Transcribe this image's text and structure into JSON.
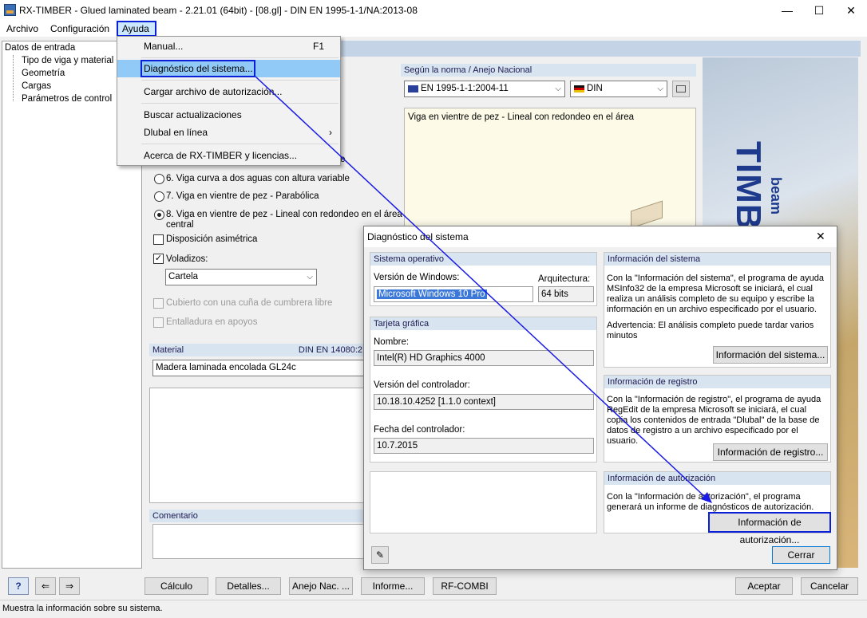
{
  "window": {
    "title": "RX-TIMBER - Glued laminated beam - 2.21.01 (64bit) - [08.gl] - DIN EN 1995-1-1/NA:2013-08",
    "minimize": "—",
    "maximize": "☐",
    "close": "✕"
  },
  "menubar": {
    "items": [
      "Archivo",
      "Configuración",
      "Ayuda"
    ]
  },
  "tree": {
    "root": "Datos de entrada",
    "children": [
      "Tipo de viga y material",
      "Geometría",
      "Cargas",
      "Parámetros de control"
    ]
  },
  "help_menu": {
    "manual": "Manual...",
    "manual_key": "F1",
    "diagnostics": "Diagnóstico del sistema...",
    "authorization": "Cargar archivo de autorización...",
    "updates": "Buscar actualizaciones",
    "online": "Dlubal en línea",
    "online_arrow": "›",
    "about": "Acerca de RX-TIMBER y licencias..."
  },
  "beam_options": {
    "partial_line": "e",
    "opt6": "6. Viga curva a dos aguas con altura variable",
    "opt7": "7. Viga en vientre de pez - Parabólica",
    "opt8_line1": "8. Viga en vientre de pez - Lineal con redondeo en el área",
    "opt8_line2": "central",
    "asym": "Disposición asimétrica",
    "overhangs": "Voladizos:",
    "overhang_type": "Cartela",
    "ridge": "Cubierto con una cuña de cumbrera libre",
    "support": "Entalladura en apoyos",
    "check_mark": "✓"
  },
  "norm": {
    "header": "Según la norma / Anejo Nacional",
    "standard": "EN 1995-1-1:2004-11",
    "annex": "DIN",
    "description": "Viga en vientre de pez - Lineal con redondeo en el área"
  },
  "material": {
    "header": "Material",
    "norm": "DIN EN 14080:2",
    "value": "Madera laminada encolada GL24c"
  },
  "comment": {
    "header": "Comentario"
  },
  "logo": {
    "text": "TIMBER",
    "sub": "beam"
  },
  "bottom_buttons": {
    "calc": "Cálculo",
    "details": "Detalles...",
    "annex": "Anejo Nac. ...",
    "report": "Informe...",
    "rfcombi": "RF-COMBI",
    "ok": "Aceptar",
    "cancel": "Cancelar"
  },
  "status": "Muestra la información sobre su sistema.",
  "dialog": {
    "title": "Diagnóstico del sistema",
    "close": "✕",
    "os_header": "Sistema operativo",
    "windows_label": "Versión de Windows:",
    "windows_value": "Microsoft Windows 10 Pro",
    "arch_label": "Arquitectura:",
    "arch_value": "64 bits",
    "gpu_header": "Tarjeta gráfica",
    "name_label": "Nombre:",
    "name_value": "Intel(R) HD Graphics 4000",
    "driver_label": "Versión del controlador:",
    "driver_value": "10.18.10.4252 [1.1.0 context]",
    "date_label": "Fecha del controlador:",
    "date_value": "10.7.2015",
    "sysinfo_header": "Información del sistema",
    "sysinfo_text": "Con la \"Información del sistema\", el programa de ayuda MSInfo32 de la empresa Microsoft se iniciará, el cual realiza un análisis completo de su equipo y escribe la información en un archivo especificado por el usuario.",
    "sysinfo_warning": "Advertencia: El análisis completo puede tardar varios minutos",
    "sysinfo_button": "Información del sistema...",
    "reg_header": "Información de registro",
    "reg_text": "Con la \"Información de registro\", el programa de ayuda RegEdit de la empresa Microsoft se iniciará, el cual copia los contenidos de entrada \"Dlubal\" de la base de datos de registro a un archivo especificado por el usuario.",
    "reg_button": "Información de registro...",
    "auth_header": "Información de autorización",
    "auth_text": "Con la \"Información de autorización\", el programa generará un informe de diagnósticos de autorización.",
    "auth_button": "Información de autorización...",
    "close_button": "Cerrar"
  },
  "colors": {
    "highlight": "#0b1fd8",
    "arrow": "#1a1ae6",
    "group_header": "#d8e4f0"
  }
}
